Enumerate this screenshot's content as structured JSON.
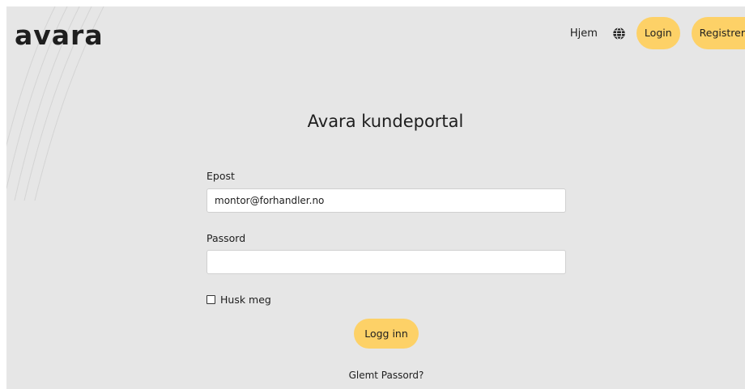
{
  "header": {
    "logo_text": "avara",
    "nav": {
      "home_label": "Hjem",
      "language_icon": "globe-icon",
      "login_label": "Login",
      "register_label": "Registrer"
    }
  },
  "main": {
    "title": "Avara kundeportal",
    "email": {
      "label": "Epost",
      "value": "montor@forhandler.no",
      "placeholder": ""
    },
    "password": {
      "label": "Passord",
      "value": "",
      "placeholder": ""
    },
    "remember": {
      "label": "Husk meg",
      "checked": false
    },
    "submit_label": "Logg inn",
    "forgot_label": "Glemt Passord?"
  },
  "colors": {
    "background": "#e6e6e6",
    "accent": "#fdd167",
    "text": "#1e1e1e",
    "input_bg": "#ffffff"
  }
}
